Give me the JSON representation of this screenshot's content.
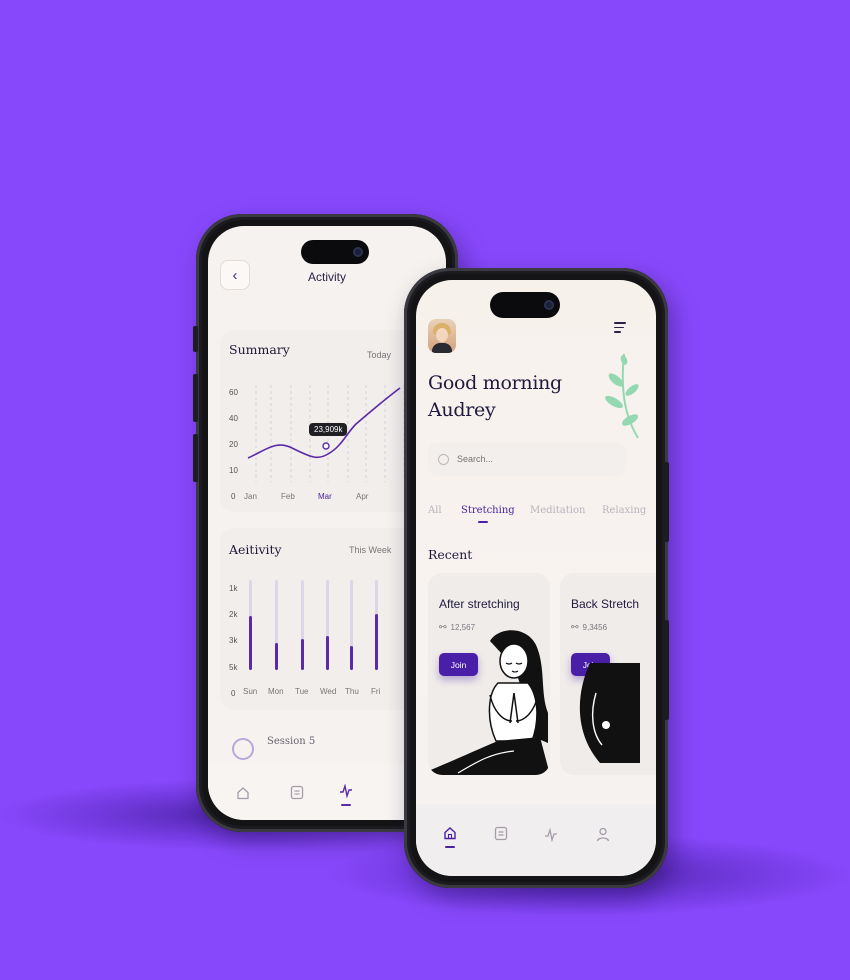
{
  "activity_screen": {
    "title": "Activity",
    "back_icon": "chevron-left-icon",
    "summary": {
      "title": "Summary",
      "period": "Today",
      "tooltip": "23,909k",
      "y_ticks": [
        "60",
        "40",
        "20",
        "10",
        "0"
      ],
      "x_ticks": [
        "Jan",
        "Feb",
        "Mar",
        "Apr"
      ],
      "active_x": "Mar"
    },
    "activity": {
      "title": "Aeitivity",
      "period": "This Week",
      "y_ticks": [
        "1k",
        "2k",
        "3k",
        "5k",
        "0"
      ],
      "x_ticks": [
        "Sun",
        "Mon",
        "Tue",
        "Wed",
        "Thu",
        "Fri"
      ]
    },
    "session_label": "Session 5",
    "nav": [
      "home-icon",
      "clipboard-icon",
      "activity-icon"
    ]
  },
  "home_screen": {
    "greeting_line1": "Good morning",
    "greeting_line2": "Audrey",
    "search_placeholder": "Search...",
    "tabs": [
      "All",
      "Stretching",
      "Meditation",
      "Relaxing"
    ],
    "active_tab": "Stretching",
    "section_title": "Recent",
    "cards": [
      {
        "title": "After stretching",
        "count": "12,567",
        "button": "Join"
      },
      {
        "title": "Back Stretch",
        "count": "9,3456",
        "button": "Join"
      }
    ],
    "nav": [
      "home-icon",
      "clipboard-icon",
      "activity-icon",
      "profile-icon"
    ]
  },
  "chart_data": [
    {
      "type": "line",
      "title": "Summary",
      "categories": [
        "Jan",
        "Feb",
        "Mar",
        "Apr"
      ],
      "series": [
        {
          "values": [
            14,
            19,
            16,
            24,
            40,
            50
          ]
        }
      ],
      "ylim": [
        0,
        60
      ],
      "annotations": [
        "23,909k"
      ],
      "grid": true
    },
    {
      "type": "bar",
      "title": "Aeitivity",
      "categories": [
        "Sun",
        "Mon",
        "Tue",
        "Wed",
        "Thu",
        "Fri"
      ],
      "values": [
        0.6,
        0.3,
        0.35,
        0.38,
        0.27,
        0.62
      ],
      "value_units": "fraction of track",
      "y_ticks": [
        "1k",
        "2k",
        "3k",
        "5k",
        "0"
      ]
    }
  ],
  "colors": {
    "background": "#8748fb",
    "accent": "#4a1fa8",
    "screen": "#f6f2ef",
    "leaf": "#93d8b0"
  }
}
